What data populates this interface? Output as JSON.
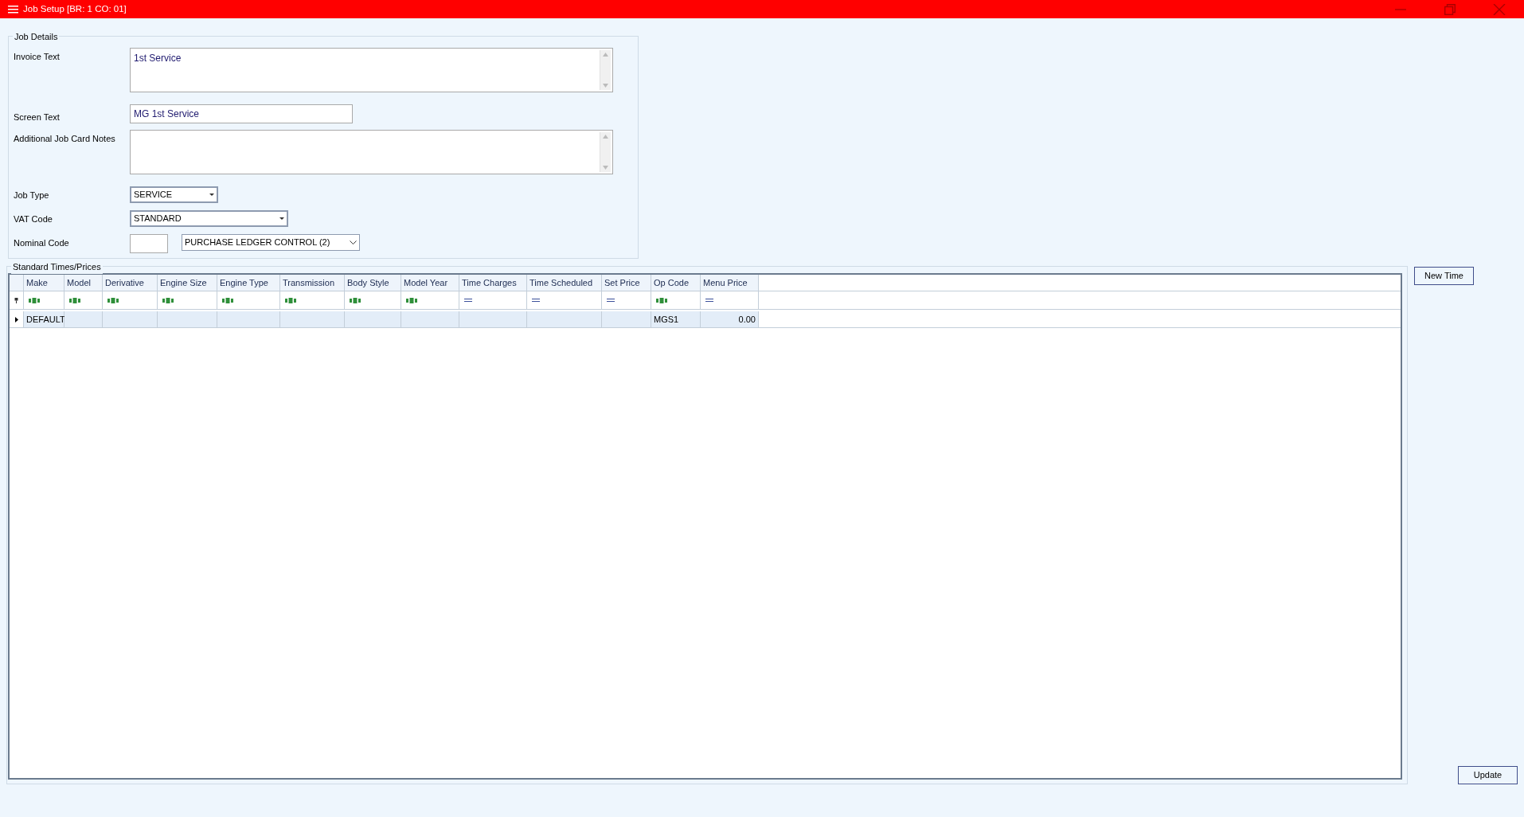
{
  "window": {
    "title": "Job Setup [BR: 1 CO: 01]"
  },
  "job_details": {
    "title": "Job Details",
    "invoice_text": {
      "label": "Invoice Text",
      "value": "1st Service"
    },
    "screen_text": {
      "label": "Screen Text",
      "value": "MG 1st Service"
    },
    "additional_notes": {
      "label": "Additional Job Card Notes"
    },
    "job_type": {
      "label": "Job Type",
      "value": "SERVICE"
    },
    "vat_code": {
      "label": "VAT Code",
      "value": "STANDARD"
    },
    "nominal_code": {
      "label": "Nominal Code",
      "value": "PURCHASE LEDGER CONTROL (2)"
    }
  },
  "standard_times": {
    "title": "Standard Times/Prices",
    "columns": [
      {
        "label": "Make",
        "kind": "text"
      },
      {
        "label": "Model",
        "kind": "text"
      },
      {
        "label": "Derivative",
        "kind": "text"
      },
      {
        "label": "Engine Size",
        "kind": "text"
      },
      {
        "label": "Engine Type",
        "kind": "text"
      },
      {
        "label": "Transmission",
        "kind": "text"
      },
      {
        "label": "Body Style",
        "kind": "text"
      },
      {
        "label": "Model Year",
        "kind": "text"
      },
      {
        "label": "Time Charges",
        "kind": "number"
      },
      {
        "label": "Time Scheduled",
        "kind": "number"
      },
      {
        "label": "Set Price",
        "kind": "number"
      },
      {
        "label": "Op Code",
        "kind": "text"
      },
      {
        "label": "Menu Price",
        "kind": "number"
      }
    ],
    "rows": [
      {
        "current": true,
        "cells": [
          "DEFAULT",
          "",
          "",
          "",
          "",
          "",
          "",
          "",
          "",
          "",
          "",
          "MGS1",
          "0.00"
        ]
      }
    ]
  },
  "buttons": {
    "new_time": "New Time",
    "update": "Update"
  }
}
